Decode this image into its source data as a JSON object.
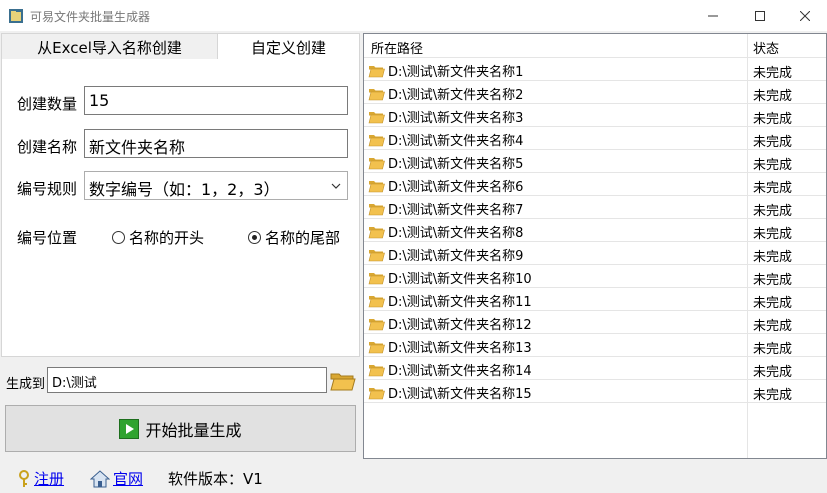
{
  "window": {
    "title": "可易文件夹批量生成器"
  },
  "tabs": [
    {
      "label": "从Excel导入名称创建"
    },
    {
      "label": "自定义创建"
    }
  ],
  "form": {
    "count_label": "创建数量",
    "count_value": "15",
    "name_label": "创建名称",
    "name_value": "新文件夹名称",
    "rule_label": "编号规则",
    "rule_value": "数字编号（如：1，2，3）",
    "position_label": "编号位置",
    "position_options": [
      {
        "label": "名称的开头",
        "checked": false
      },
      {
        "label": "名称的尾部",
        "checked": true
      }
    ]
  },
  "output": {
    "label": "生成到",
    "value": "D:\\测试"
  },
  "start_button": {
    "label": "开始批量生成"
  },
  "list": {
    "columns": [
      "所在路径",
      "状态"
    ],
    "rows": [
      {
        "path": "D:\\测试\\新文件夹名称1",
        "status": "未完成"
      },
      {
        "path": "D:\\测试\\新文件夹名称2",
        "status": "未完成"
      },
      {
        "path": "D:\\测试\\新文件夹名称3",
        "status": "未完成"
      },
      {
        "path": "D:\\测试\\新文件夹名称4",
        "status": "未完成"
      },
      {
        "path": "D:\\测试\\新文件夹名称5",
        "status": "未完成"
      },
      {
        "path": "D:\\测试\\新文件夹名称6",
        "status": "未完成"
      },
      {
        "path": "D:\\测试\\新文件夹名称7",
        "status": "未完成"
      },
      {
        "path": "D:\\测试\\新文件夹名称8",
        "status": "未完成"
      },
      {
        "path": "D:\\测试\\新文件夹名称9",
        "status": "未完成"
      },
      {
        "path": "D:\\测试\\新文件夹名称10",
        "status": "未完成"
      },
      {
        "path": "D:\\测试\\新文件夹名称11",
        "status": "未完成"
      },
      {
        "path": "D:\\测试\\新文件夹名称12",
        "status": "未完成"
      },
      {
        "path": "D:\\测试\\新文件夹名称13",
        "status": "未完成"
      },
      {
        "path": "D:\\测试\\新文件夹名称14",
        "status": "未完成"
      },
      {
        "path": "D:\\测试\\新文件夹名称15",
        "status": "未完成"
      }
    ]
  },
  "footer": {
    "register_label": "注册",
    "website_label": "官网",
    "version_label": "软件版本：V1"
  },
  "icons": {
    "app": "app-icon",
    "folder": "folder-icon",
    "play": "play-icon",
    "key": "key-icon",
    "home": "home-icon"
  },
  "colors": {
    "link": "#0000ee",
    "folder": "#f2c14e",
    "play": "#2fa32f"
  }
}
